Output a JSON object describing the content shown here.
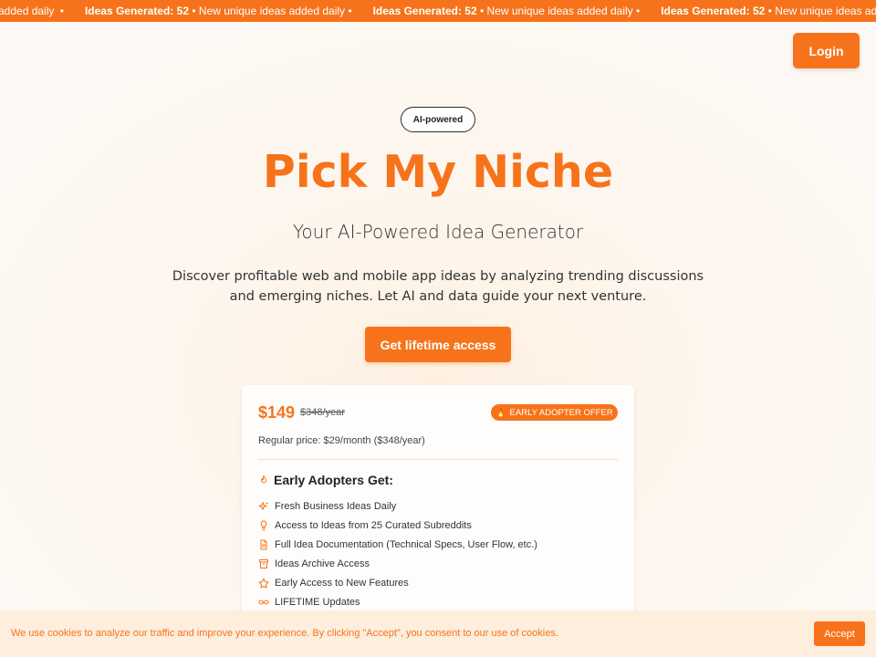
{
  "ticker": {
    "segments": [
      {
        "label": "",
        "value": "",
        "text": "added daily"
      },
      {
        "label": "Ideas Generated:",
        "value": "52",
        "text": "New unique ideas added daily"
      },
      {
        "label": "Ideas Generated:",
        "value": "52",
        "text": "New unique ideas added daily"
      },
      {
        "label": "Ideas Generated:",
        "value": "52",
        "text": "New unique ideas added"
      }
    ],
    "separator": "•"
  },
  "header": {
    "login_label": "Login"
  },
  "hero": {
    "badge": "AI-powered",
    "title": "Pick My Niche",
    "subtitle": "Your AI-Powered Idea Generator",
    "description": "Discover profitable web and mobile app ideas by analyzing trending discussions and emerging niches. Let AI and data guide your next venture.",
    "cta_label": "Get lifetime access"
  },
  "pricing": {
    "price": "$149",
    "old_price": "$348/year",
    "offer_badge": "EARLY ADOPTER OFFER",
    "offer_icon": "fire-icon",
    "regular_price": "Regular price: $29/month ($348/year)",
    "features_heading": "Early Adopters Get:",
    "features": [
      {
        "icon": "sparkles-icon",
        "text": "Fresh Business Ideas Daily"
      },
      {
        "icon": "lightbulb-icon",
        "text": "Access to Ideas from 25 Curated Subreddits"
      },
      {
        "icon": "document-icon",
        "text": "Full Idea Documentation (Technical Specs, User Flow, etc.)"
      },
      {
        "icon": "archive-icon",
        "text": "Ideas Archive Access"
      },
      {
        "icon": "star-icon",
        "text": "Early Access to New Features"
      },
      {
        "icon": "infinity-icon",
        "text": "LIFETIME Updates"
      }
    ]
  },
  "cookie": {
    "text": "We use cookies to analyze our traffic and improve your experience. By clicking \"Accept\", you consent to our use of cookies.",
    "accept_label": "Accept"
  },
  "colors": {
    "accent": "#f7731b",
    "background": "#fdf8f3"
  }
}
